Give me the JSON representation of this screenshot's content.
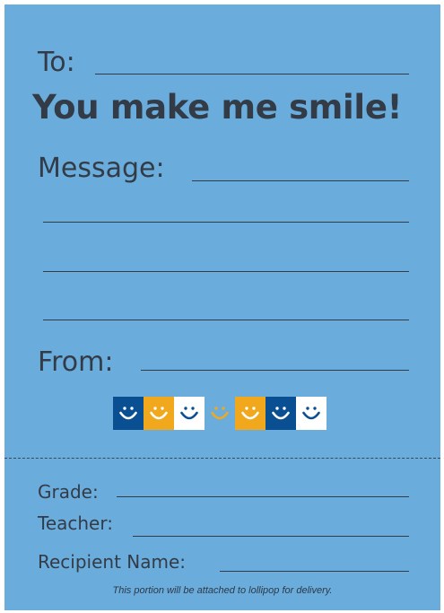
{
  "card": {
    "background": "#6aaddc",
    "to_label": "To:",
    "headline": "You make me smile!",
    "message_label": "Message:",
    "from_label": "From:",
    "smileys": [
      {
        "bg": "#0b4f93",
        "fg": "#ffffff"
      },
      {
        "bg": "#f2a81d",
        "fg": "#ffffff"
      },
      {
        "bg": "#ffffff",
        "fg": "#0b4f93"
      },
      {
        "bg": "#6aaddc",
        "fg": "#f2a81d"
      },
      {
        "bg": "#f2a81d",
        "fg": "#ffffff"
      },
      {
        "bg": "#0b4f93",
        "fg": "#ffffff"
      },
      {
        "bg": "#ffffff",
        "fg": "#0b4f93"
      }
    ]
  },
  "tear_off": {
    "grade_label": "Grade:",
    "teacher_label": "Teacher:",
    "recipient_label": "Recipient Name:",
    "footnote": "This portion will be attached to lollipop for delivery."
  }
}
